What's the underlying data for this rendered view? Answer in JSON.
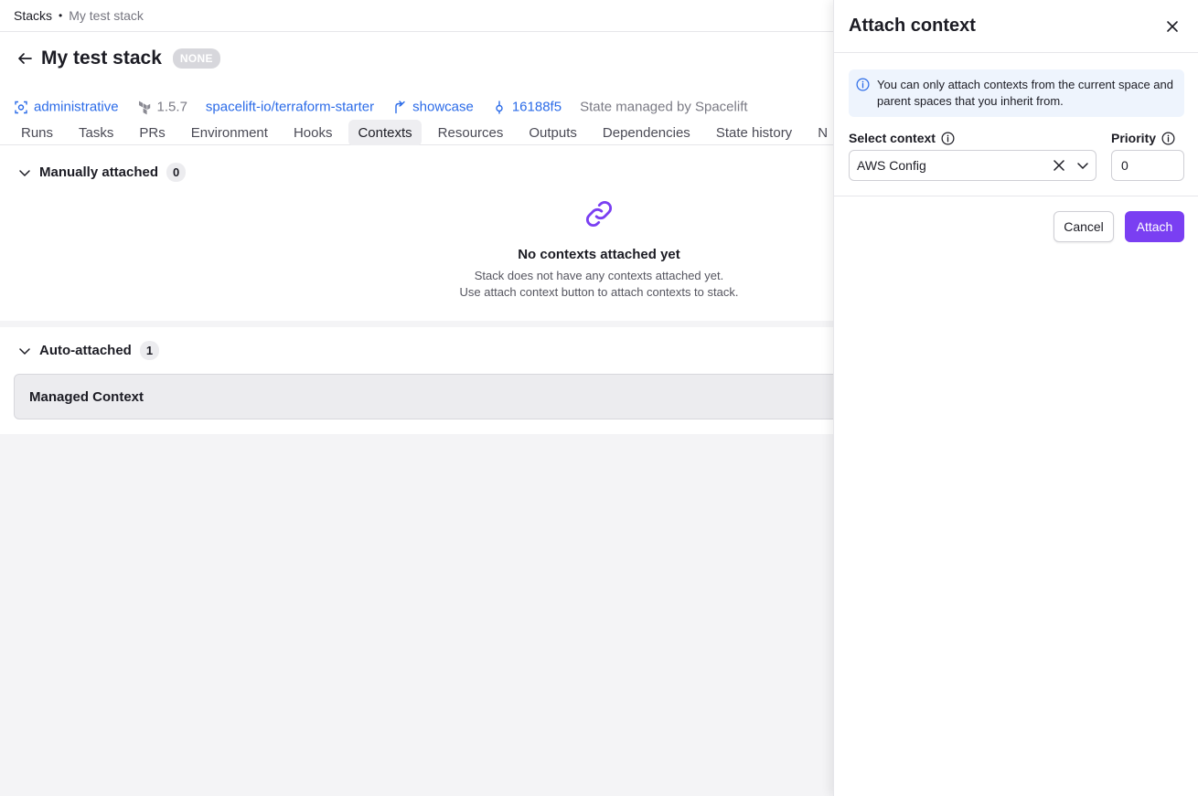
{
  "breadcrumb": {
    "root": "Stacks",
    "separator": "•",
    "current": "My test stack"
  },
  "stack": {
    "title": "My test stack",
    "badge": "NONE",
    "space": "administrative",
    "tool_version": "1.5.7",
    "repository": "spacelift-io/terraform-starter",
    "branch": "showcase",
    "commit": "16188f5",
    "state_note": "State managed by Spacelift"
  },
  "tabs": [
    {
      "label": "Runs"
    },
    {
      "label": "Tasks"
    },
    {
      "label": "PRs"
    },
    {
      "label": "Environment"
    },
    {
      "label": "Hooks"
    },
    {
      "label": "Contexts",
      "active": true
    },
    {
      "label": "Resources"
    },
    {
      "label": "Outputs"
    },
    {
      "label": "Dependencies"
    },
    {
      "label": "State history"
    },
    {
      "label": "N"
    }
  ],
  "manual": {
    "title": "Manually attached",
    "count": "0",
    "empty_title": "No contexts attached yet",
    "empty_line1": "Stack does not have any contexts attached yet.",
    "empty_line2": "Use attach context button to attach contexts to stack."
  },
  "auto": {
    "title": "Auto-attached",
    "count": "1",
    "items": [
      {
        "name": "Managed Context"
      }
    ]
  },
  "panel": {
    "title": "Attach context",
    "info": "You can only attach contexts from the current space and parent spaces that you inherit from.",
    "select_label": "Select context",
    "select_value": "AWS Config",
    "priority_label": "Priority",
    "priority_value": "0",
    "cancel_label": "Cancel",
    "attach_label": "Attach"
  },
  "colors": {
    "accent": "#7a3ff2",
    "link": "#2b6be8",
    "info_bg": "#eef4fd"
  }
}
